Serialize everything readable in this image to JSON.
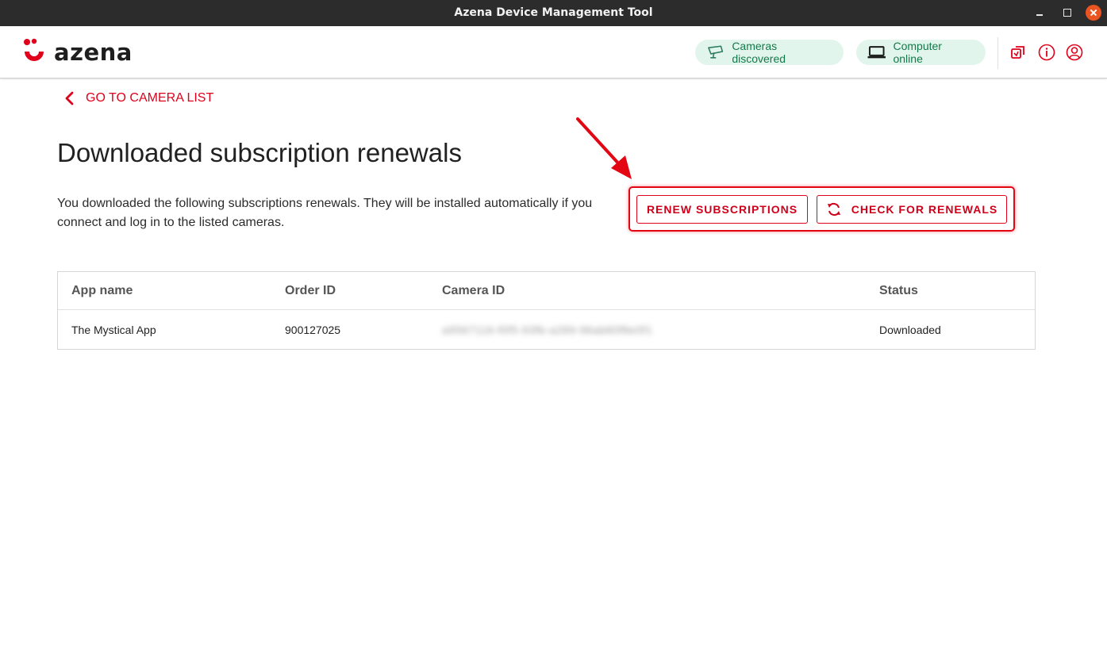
{
  "window": {
    "title": "Azena Device Management Tool"
  },
  "header": {
    "logo_text": "azena",
    "chips": {
      "cameras": "Cameras discovered",
      "computer": "Computer online"
    },
    "icons": [
      "sync-icon",
      "info-icon",
      "user-icon"
    ]
  },
  "nav": {
    "back_label": "GO TO CAMERA LIST"
  },
  "page": {
    "title": "Downloaded subscription renewals",
    "description": "You downloaded the following subscriptions renewals. They will be installed automatically if you connect and log in to the listed cameras."
  },
  "actions": {
    "renew_label": "RENEW SUBSCRIPTIONS",
    "check_label": "CHECK FOR RENEWALS"
  },
  "table": {
    "headers": [
      "App name",
      "Order ID",
      "Camera ID",
      "Status"
    ],
    "rows": [
      {
        "app_name": "The Mystical App",
        "order_id": "900127025",
        "camera_id": "a9567116-f0f5-93fb-a289-96ab80f8e0f1",
        "status": "Downloaded"
      }
    ]
  },
  "colors": {
    "brand_red": "#e0001b",
    "chip_bg": "#e2f5ec",
    "chip_text": "#127a4a",
    "titlebar": "#2c2c2c"
  }
}
